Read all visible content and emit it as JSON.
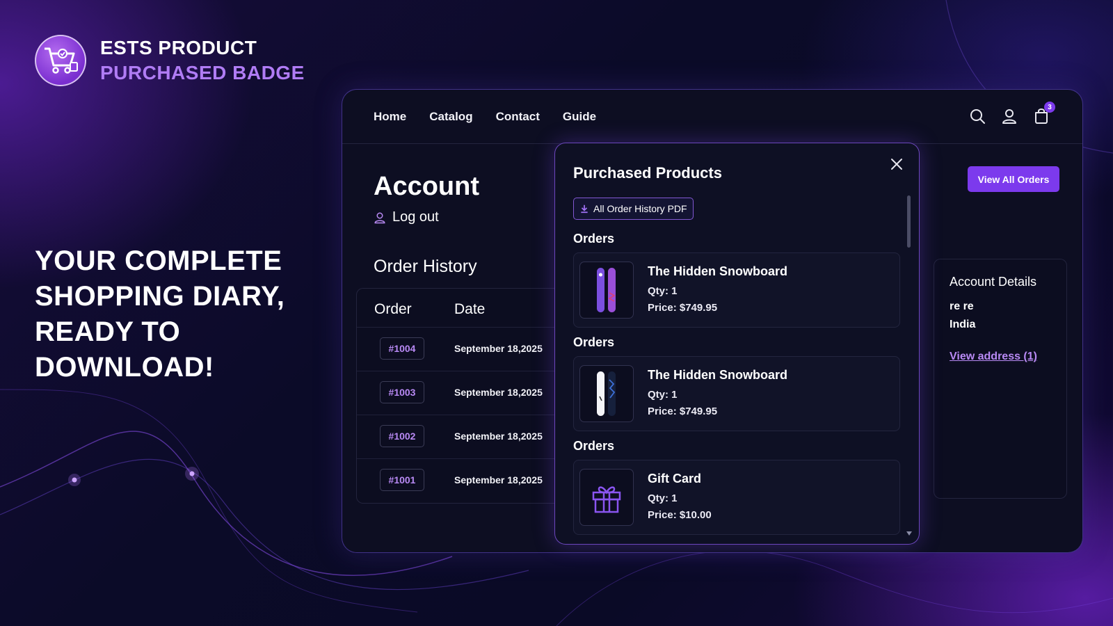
{
  "brand": {
    "line1": "ESTS PRODUCT",
    "line2": "PURCHASED BADGE",
    "logo_icon": "shopping-cart-badge-icon"
  },
  "headline": {
    "lines": [
      "YOUR COMPLETE",
      "SHOPPING DIARY,",
      "READY TO",
      "DOWNLOAD!"
    ]
  },
  "nav": {
    "links": [
      "Home",
      "Catalog",
      "Contact",
      "Guide"
    ],
    "cart_count": "3"
  },
  "account": {
    "title": "Account",
    "logout_label": "Log out",
    "order_history_title": "Order History",
    "view_all_label": "View All Orders",
    "table": {
      "headers": {
        "order": "Order",
        "date": "Date"
      },
      "rows": [
        {
          "order": "#1004",
          "date": "September 18,2025"
        },
        {
          "order": "#1003",
          "date": "September 18,2025"
        },
        {
          "order": "#1002",
          "date": "September 18,2025"
        },
        {
          "order": "#1001",
          "date": "September 18,2025"
        }
      ]
    },
    "details": {
      "title": "Account Details",
      "name": "re re",
      "country": "India",
      "address_link": "View address (1)"
    }
  },
  "modal": {
    "title": "Purchased Products",
    "pdf_label": "All Order History PDF",
    "groups": [
      {
        "label": "Orders",
        "name": "The Hidden Snowboard",
        "qty": "Qty: 1",
        "price": "Price: $749.95",
        "thumb": "snowboard-purple"
      },
      {
        "label": "Orders",
        "name": "The Hidden Snowboard",
        "qty": "Qty: 1",
        "price": "Price: $749.95",
        "thumb": "snowboard-white"
      },
      {
        "label": "Orders",
        "name": "Gift Card",
        "qty": "Qty: 1",
        "price": "Price: $10.00",
        "thumb": "gift-icon"
      }
    ]
  },
  "colors": {
    "accent": "#7c3aed",
    "accent_text": "#b98af5",
    "background": "#0a0a24",
    "panel": "#0d0e22"
  }
}
